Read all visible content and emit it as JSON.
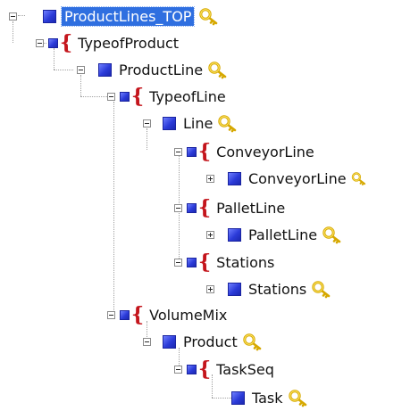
{
  "colors": {
    "entity_icon": "#3344dd",
    "relation_brace": "#c4151c",
    "selection": "#2f6fe0",
    "key_icon": "#e8c520"
  },
  "tree": {
    "root": "ProductLines_TOP",
    "typeofproduct": "TypeofProduct",
    "productline": "ProductLine",
    "typeofline": "TypeofLine",
    "line": "Line",
    "conveyorline_rel": "ConveyorLine",
    "conveyorline": "ConveyorLine",
    "palletline_rel": "PalletLine",
    "palletline": "PalletLine",
    "stations_rel": "Stations",
    "stations": "Stations",
    "volumemix": "VolumeMix",
    "product": "Product",
    "taskseq": "TaskSeq",
    "task": "Task"
  }
}
